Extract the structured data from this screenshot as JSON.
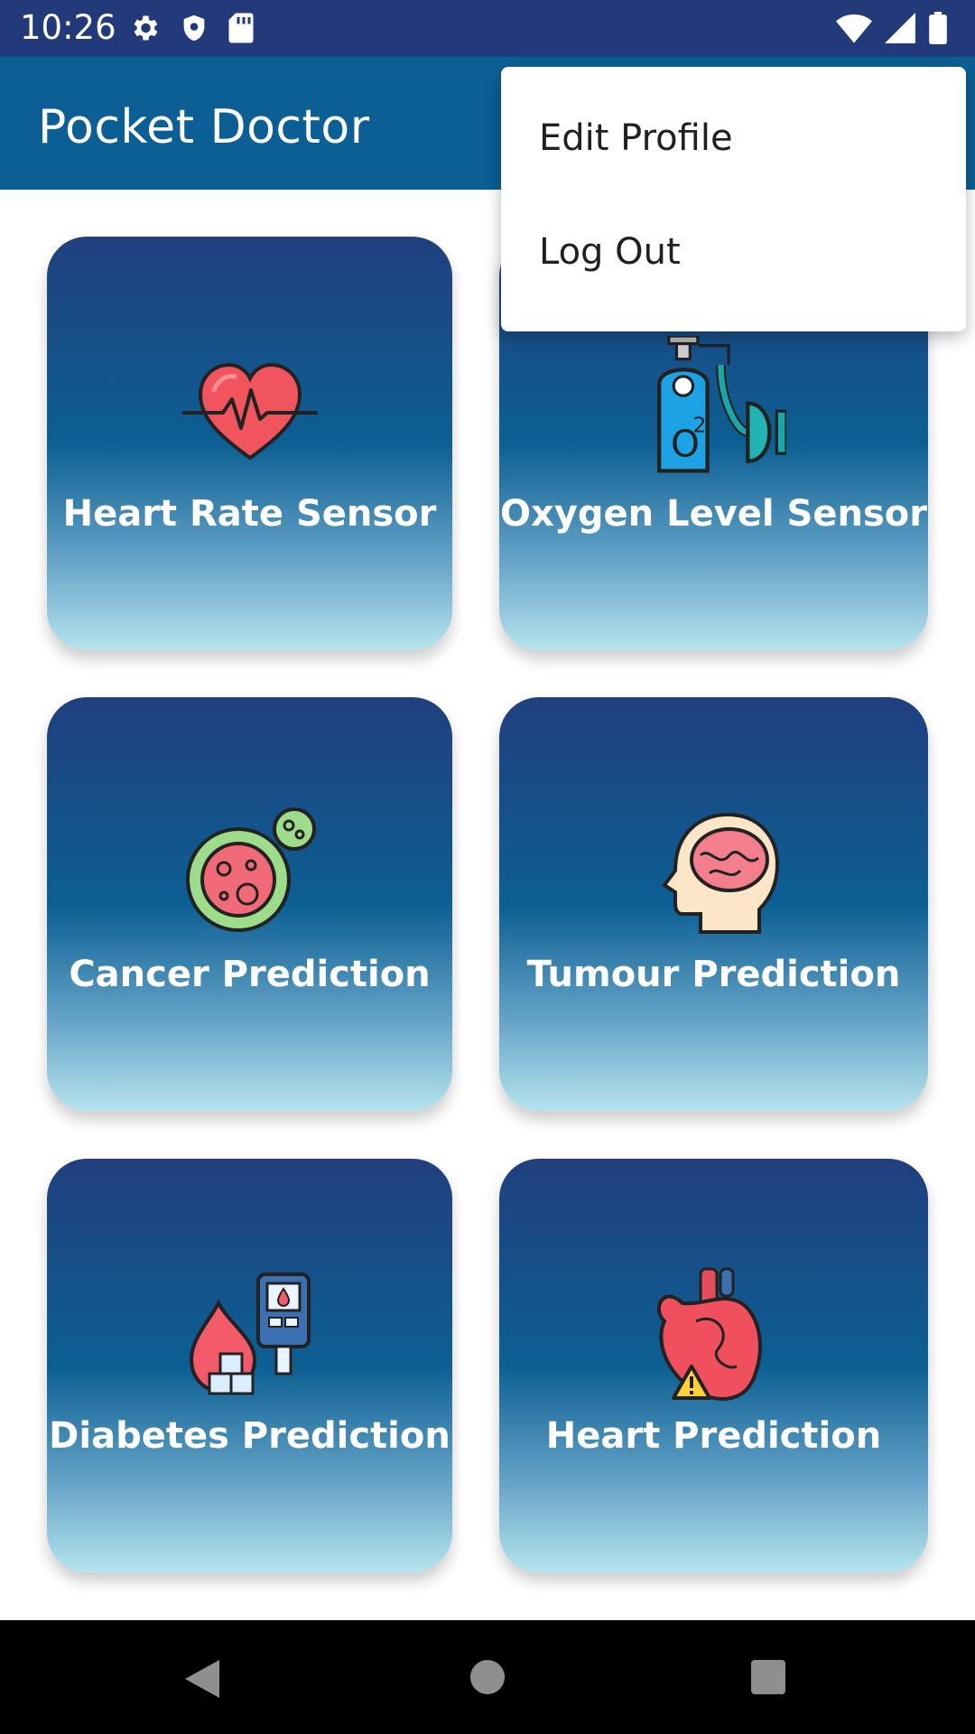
{
  "status_bar": {
    "time": "10:26",
    "left_icons": [
      "gear-icon",
      "shield-icon",
      "sd-card-icon"
    ],
    "right_icons": [
      "wifi-icon",
      "signal-icon",
      "battery-icon"
    ]
  },
  "app_bar": {
    "title": "Pocket Doctor"
  },
  "menu": {
    "items": [
      {
        "label": "Edit Profile"
      },
      {
        "label": "Log Out"
      }
    ]
  },
  "cards": [
    {
      "label": "Heart Rate Sensor",
      "icon": "heart-rate-icon"
    },
    {
      "label": "Oxygen Level Sensor",
      "icon": "oxygen-tank-icon"
    },
    {
      "label": "Cancer Prediction",
      "icon": "cancer-cell-icon"
    },
    {
      "label": "Tumour Prediction",
      "icon": "brain-head-icon"
    },
    {
      "label": "Diabetes Prediction",
      "icon": "glucose-meter-icon"
    },
    {
      "label": "Heart Prediction",
      "icon": "heart-warning-icon"
    }
  ],
  "nav_bar": {
    "buttons": [
      "back-icon",
      "home-icon",
      "recents-icon"
    ]
  },
  "colors": {
    "status_bar": "#233a7a",
    "app_bar": "#0c5f95",
    "card_top": "#213f7e",
    "card_bottom": "#b6e4ee"
  }
}
